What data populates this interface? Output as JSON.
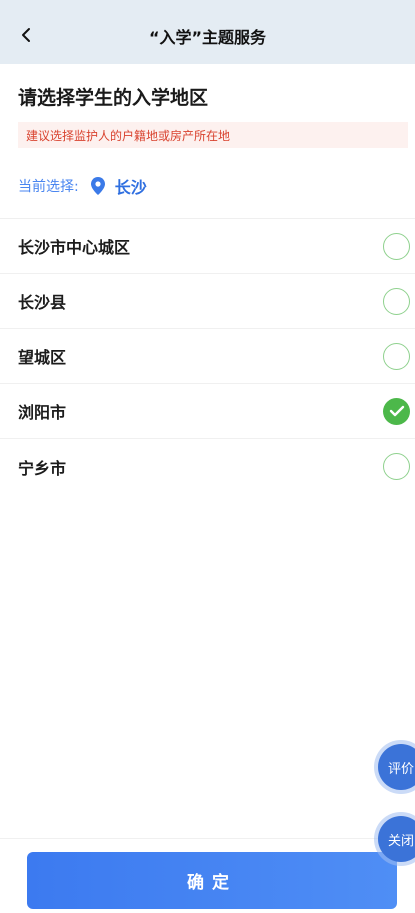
{
  "header": {
    "title": "“入学”主题服务",
    "back_icon": "chevron-left-icon"
  },
  "page": {
    "heading": "请选择学生的入学地区",
    "tip": "建议选择监护人的户籍地或房产所在地",
    "current_label": "当前选择:",
    "current_value": "长沙",
    "pin_icon": "location-pin-icon"
  },
  "regions": [
    {
      "label": "长沙市中心城区",
      "selected": false
    },
    {
      "label": "长沙县",
      "selected": false
    },
    {
      "label": "望城区",
      "selected": false
    },
    {
      "label": "浏阳市",
      "selected": true
    },
    {
      "label": "宁乡市",
      "selected": false
    }
  ],
  "floating": {
    "eval_label": "评价",
    "close_label": "关闭"
  },
  "footer": {
    "confirm_label": "确定"
  },
  "colors": {
    "accent": "#3b73d8",
    "check": "#4cb84a",
    "tip_text": "#d9432f",
    "tip_bg": "#fdf1ef",
    "navbar_bg": "#e4ecf3"
  }
}
